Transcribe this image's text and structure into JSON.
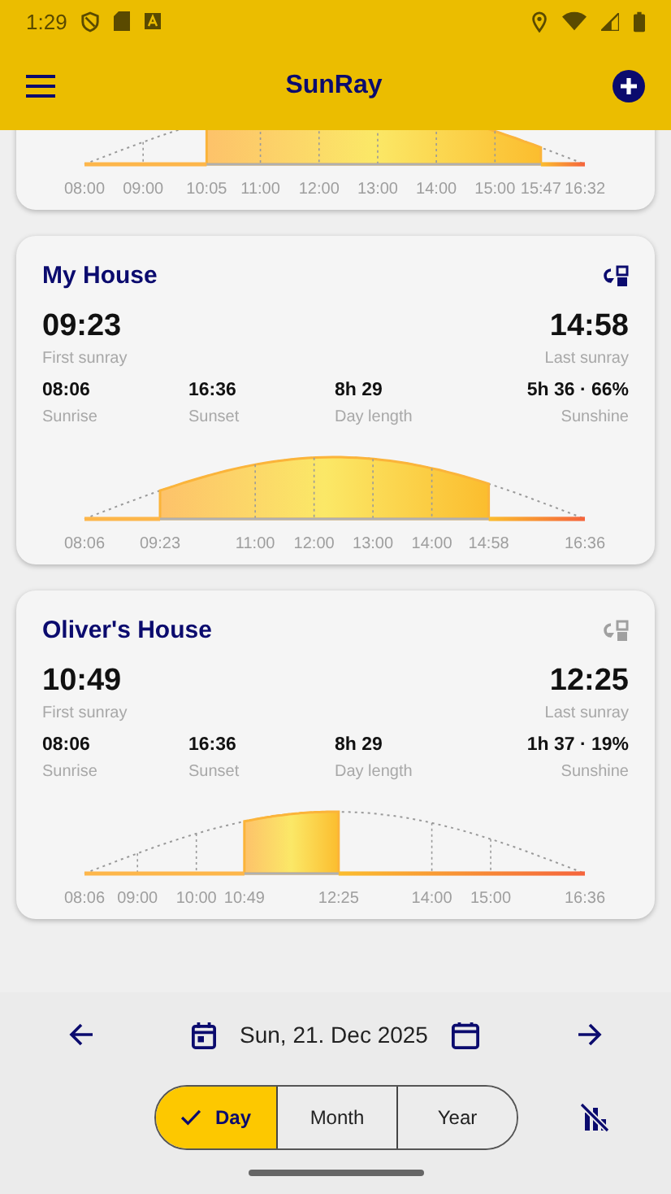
{
  "status_bar": {
    "time": "1:29"
  },
  "app_bar": {
    "title": "SunRay"
  },
  "locations": [
    {
      "chart": {
        "labels": [
          {
            "text": "08:00",
            "kind": "sunrise"
          },
          {
            "text": "09:00",
            "kind": "hour"
          },
          {
            "text": "10:05",
            "kind": "first"
          },
          {
            "text": "11:00",
            "kind": "hour"
          },
          {
            "text": "12:00",
            "kind": "hour"
          },
          {
            "text": "13:00",
            "kind": "hour"
          },
          {
            "text": "14:00",
            "kind": "hour"
          },
          {
            "text": "15:00",
            "kind": "hour"
          },
          {
            "text": "15:47",
            "kind": "last"
          },
          {
            "text": "16:32",
            "kind": "sunset"
          }
        ]
      }
    },
    {
      "name": "My House",
      "active": true,
      "first_sunray": {
        "value": "09:23",
        "label": "First sunray"
      },
      "last_sunray": {
        "value": "14:58",
        "label": "Last sunray"
      },
      "stats": [
        {
          "value": "08:06",
          "label": "Sunrise"
        },
        {
          "value": "16:36",
          "label": "Sunset"
        },
        {
          "value": "8h 29",
          "label": "Day length"
        },
        {
          "value": "5h 36 · 66%",
          "label": "Sunshine"
        }
      ],
      "chart": {
        "labels": [
          {
            "text": "08:06",
            "kind": "sunrise"
          },
          {
            "text": "09:23",
            "kind": "first"
          },
          {
            "text": "11:00",
            "kind": "hour"
          },
          {
            "text": "12:00",
            "kind": "hour"
          },
          {
            "text": "13:00",
            "kind": "hour"
          },
          {
            "text": "14:00",
            "kind": "hour"
          },
          {
            "text": "14:58",
            "kind": "last"
          },
          {
            "text": "16:36",
            "kind": "sunset"
          }
        ]
      }
    },
    {
      "name": "Oliver's House",
      "active": false,
      "first_sunray": {
        "value": "10:49",
        "label": "First sunray"
      },
      "last_sunray": {
        "value": "12:25",
        "label": "Last sunray"
      },
      "stats": [
        {
          "value": "08:06",
          "label": "Sunrise"
        },
        {
          "value": "16:36",
          "label": "Sunset"
        },
        {
          "value": "8h 29",
          "label": "Day length"
        },
        {
          "value": "1h 37 · 19%",
          "label": "Sunshine"
        }
      ],
      "chart": {
        "labels": [
          {
            "text": "08:06",
            "kind": "sunrise"
          },
          {
            "text": "09:00",
            "kind": "hour"
          },
          {
            "text": "10:00",
            "kind": "hour"
          },
          {
            "text": "10:49",
            "kind": "first"
          },
          {
            "text": "12:25",
            "kind": "last"
          },
          {
            "text": "14:00",
            "kind": "hour"
          },
          {
            "text": "15:00",
            "kind": "hour"
          },
          {
            "text": "16:36",
            "kind": "sunset"
          }
        ]
      }
    }
  ],
  "date_bar": {
    "date": "Sun, 21. Dec 2025"
  },
  "period_tabs": [
    {
      "label": "Day",
      "selected": true
    },
    {
      "label": "Month",
      "selected": false
    },
    {
      "label": "Year",
      "selected": false
    }
  ]
}
